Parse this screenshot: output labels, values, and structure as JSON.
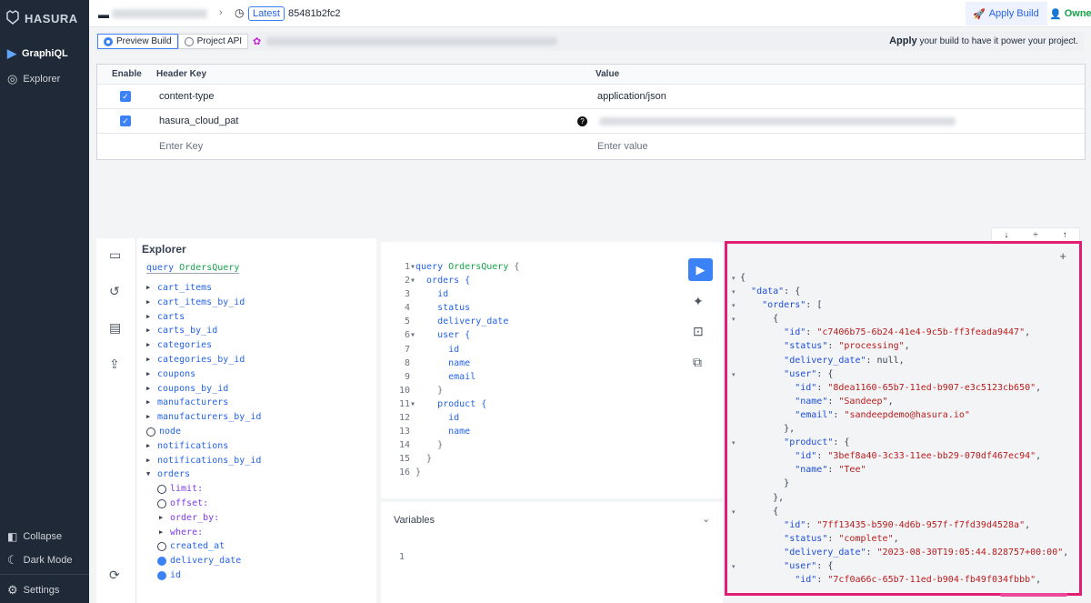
{
  "sidebar": {
    "brand": "HASURA",
    "items": [
      {
        "label": "GraphiQL"
      },
      {
        "label": "Explorer"
      }
    ],
    "collapse": "Collapse",
    "dark_mode": "Dark Mode",
    "settings": "Settings"
  },
  "topbar": {
    "latest": "Latest",
    "build_id": "85481b2fc2",
    "apply_build": "Apply Build",
    "owner": "Owner"
  },
  "buildbar": {
    "preview": "Preview Build",
    "project_api": "Project API",
    "apply": "Apply",
    "apply_text": "your build to have it power your project."
  },
  "headers": {
    "col_enable": "Enable",
    "col_key": "Header Key",
    "col_value": "Value",
    "rows": [
      {
        "key": "content-type",
        "value": "application/json"
      },
      {
        "key": "hasura_cloud_pat",
        "value": ""
      }
    ],
    "key_placeholder": "Enter Key",
    "value_placeholder": "Enter value"
  },
  "explorer": {
    "title": "Explorer",
    "query_kw": "query",
    "query_name": "OrdersQuery",
    "fields": [
      "cart_items",
      "cart_items_by_id",
      "carts",
      "carts_by_id",
      "categories",
      "categories_by_id",
      "coupons",
      "coupons_by_id",
      "manufacturers",
      "manufacturers_by_id",
      "node",
      "notifications",
      "notifications_by_id",
      "orders"
    ],
    "args": [
      "limit:",
      "offset:",
      "order_by:",
      "where:",
      "created_at",
      "delivery_date",
      "id"
    ]
  },
  "editor": {
    "lines": [
      "query OrdersQuery {",
      "  orders {",
      "    id",
      "    status",
      "    delivery_date",
      "    user {",
      "      id",
      "      name",
      "      email",
      "    }",
      "    product {",
      "      id",
      "      name",
      "    }",
      "  }",
      "}"
    ]
  },
  "variables": {
    "title": "Variables",
    "line": "1"
  },
  "result": {
    "lines": [
      "{",
      "  \"data\": {",
      "    \"orders\": [",
      "      {",
      "        \"id\": \"c7406b75-6b24-41e4-9c5b-ff3feada9447\",",
      "        \"status\": \"processing\",",
      "        \"delivery_date\": null,",
      "        \"user\": {",
      "          \"id\": \"8dea1160-65b7-11ed-b907-e3c5123cb650\",",
      "          \"name\": \"Sandeep\",",
      "          \"email\": \"sandeepdemo@hasura.io\"",
      "        },",
      "        \"product\": {",
      "          \"id\": \"3bef8a40-3c33-11ee-bb29-070df467ec94\",",
      "          \"name\": \"Tee\"",
      "        }",
      "      },",
      "      {",
      "        \"id\": \"7ff13435-b590-4d6b-957f-f7fd39d4528a\",",
      "        \"status\": \"complete\",",
      "        \"delivery_date\": \"2023-08-30T19:05:44.828757+00:00\",",
      "        \"user\": {",
      "          \"id\": \"7cf0a66c-65b7-11ed-b904-fb49f034fbbb\","
    ]
  }
}
